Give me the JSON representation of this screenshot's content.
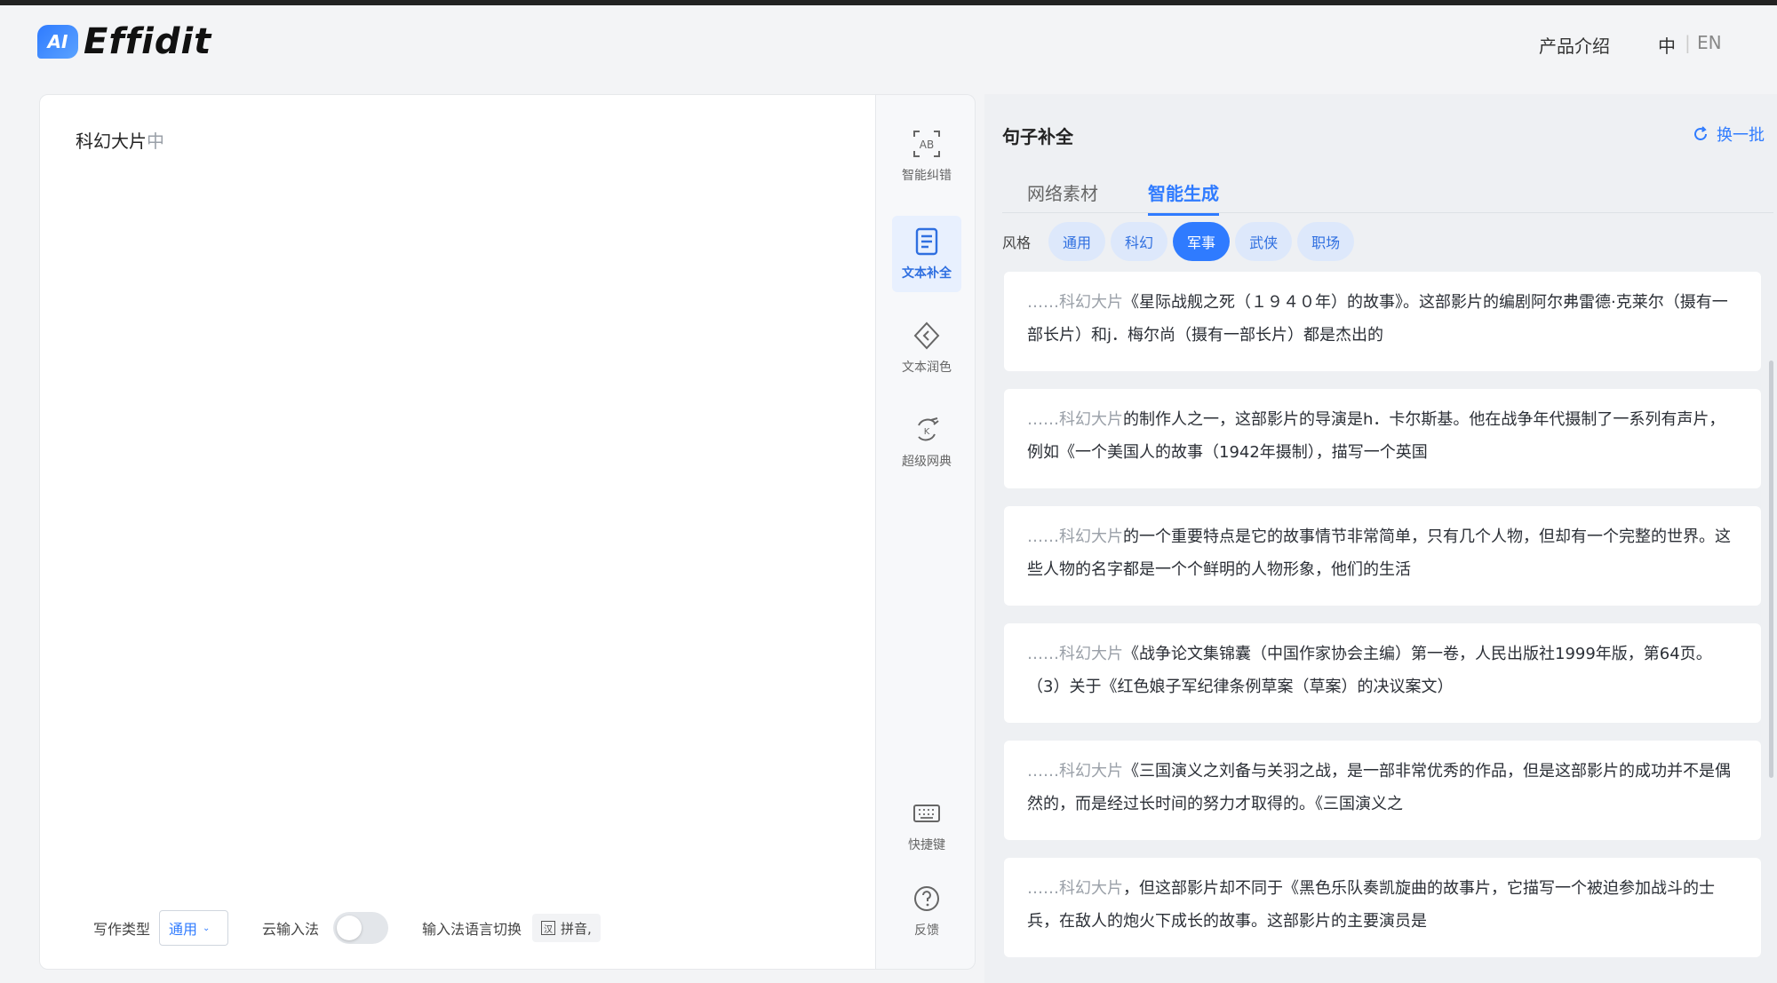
{
  "header": {
    "logo_badge": "AI",
    "logo_text": "Effidit",
    "nav_product": "产品介绍",
    "lang_zh": "中",
    "lang_sep": "|",
    "lang_en": "EN"
  },
  "editor": {
    "text_main": "科幻大片",
    "text_ghost": "中",
    "footer": {
      "write_type_label": "写作类型",
      "write_type_value": "通用",
      "cloud_ime_label": "云输入法",
      "ime_switch_label": "输入法语言切换",
      "pinyin_box": "汉",
      "pinyin_label": "拼音,"
    }
  },
  "toolbar": {
    "items": [
      {
        "label": "智能纠错",
        "icon": "spell-check-icon"
      },
      {
        "label": "文本补全",
        "icon": "text-complete-icon"
      },
      {
        "label": "文本润色",
        "icon": "text-polish-icon"
      },
      {
        "label": "超级网典",
        "icon": "super-dictionary-icon"
      },
      {
        "label": "快捷键",
        "icon": "keyboard-icon"
      },
      {
        "label": "反馈",
        "icon": "help-icon"
      }
    ]
  },
  "right_panel": {
    "title": "句子补全",
    "refresh_label": "换一批",
    "tabs": [
      {
        "label": "网络素材"
      },
      {
        "label": "智能生成"
      }
    ],
    "style_label": "风格",
    "styles": [
      {
        "label": "通用"
      },
      {
        "label": "科幻"
      },
      {
        "label": "军事"
      },
      {
        "label": "武侠"
      },
      {
        "label": "职场"
      }
    ],
    "results": [
      {
        "lead": "……科幻大片",
        "text": "《星际战舰之死（１９４０年）的故事》。这部影片的编剧阿尔弗雷德·克莱尔（摄有一部长片）和j．梅尔尚（摄有一部长片）都是杰出的"
      },
      {
        "lead": "……科幻大片",
        "text": "的制作人之一，这部影片的导演是h．卡尔斯基。他在战争年代摄制了一系列有声片，例如《一个美国人的故事（1942年摄制），描写一个英国"
      },
      {
        "lead": "……科幻大片",
        "text": "的一个重要特点是它的故事情节非常简单，只有几个人物，但却有一个完整的世界。这些人物的名字都是一个个鲜明的人物形象，他们的生活"
      },
      {
        "lead": "……科幻大片",
        "text": "《战争论文集锦囊（中国作家协会主编）第一卷，人民出版社1999年版，第64页。（3）关于《红色娘子军纪律条例草案（草案）的决议案文）"
      },
      {
        "lead": "……科幻大片",
        "text": "《三国演义之刘备与关羽之战，是一部非常优秀的作品，但是这部影片的成功并不是偶然的，而是经过长时间的努力才取得的。《三国演义之"
      },
      {
        "lead": "……科幻大片",
        "text": "，但这部影片却不同于《黑色乐队奏凯旋曲的故事片，它描写一个被迫参加战斗的士兵，在敌人的炮火下成长的故事。这部影片的主要演员是"
      }
    ]
  }
}
